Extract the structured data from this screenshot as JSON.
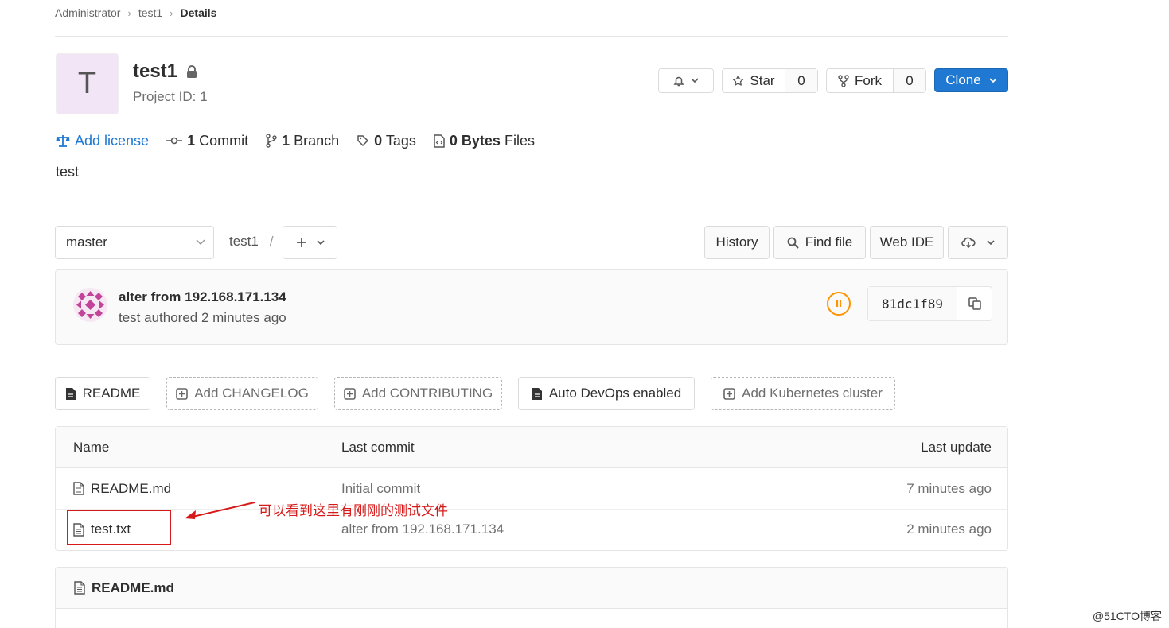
{
  "breadcrumb": [
    "Administrator",
    "test1",
    "Details"
  ],
  "project": {
    "avatar_letter": "T",
    "name": "test1",
    "id_text": "Project ID: 1",
    "description": "test"
  },
  "actions": {
    "star_label": "Star",
    "star_count": "0",
    "fork_label": "Fork",
    "fork_count": "0",
    "clone_label": "Clone"
  },
  "stats": {
    "license_label": "Add license",
    "commit_count": "1",
    "commit_label": "Commit",
    "branch_count": "1",
    "branch_label": "Branch",
    "tag_count": "0",
    "tag_label": "Tags",
    "files_size": "0 Bytes",
    "files_label": "Files"
  },
  "tree_controls": {
    "branch": "master",
    "path_root": "test1",
    "path_sep": "/",
    "history": "History",
    "find_file": "Find file",
    "web_ide": "Web IDE"
  },
  "last_commit": {
    "title": "alter from 192.168.171.134",
    "meta": "test authored 2 minutes ago",
    "sha": "81dc1f89",
    "pipeline_status_color": "#fc9403"
  },
  "quick_links": {
    "readme": "README",
    "changelog": "Add CHANGELOG",
    "contributing": "Add CONTRIBUTING",
    "autodevops": "Auto DevOps enabled",
    "kubernetes": "Add Kubernetes cluster"
  },
  "file_table": {
    "headers": {
      "name": "Name",
      "commit": "Last commit",
      "update": "Last update"
    },
    "rows": [
      {
        "name": "README.md",
        "commit": "Initial commit",
        "update": "7 minutes ago"
      },
      {
        "name": "test.txt",
        "commit": "alter from 192.168.171.134",
        "update": "2 minutes ago"
      }
    ]
  },
  "annotation": {
    "text": "可以看到这里有刚刚的测试文件",
    "color": "#d61a1a"
  },
  "readme_panel": {
    "title": "README.md"
  },
  "watermark": "@51CTO博客",
  "colors": {
    "primary": "#1f78d1",
    "avatar_bg": "#f2e5f6"
  }
}
